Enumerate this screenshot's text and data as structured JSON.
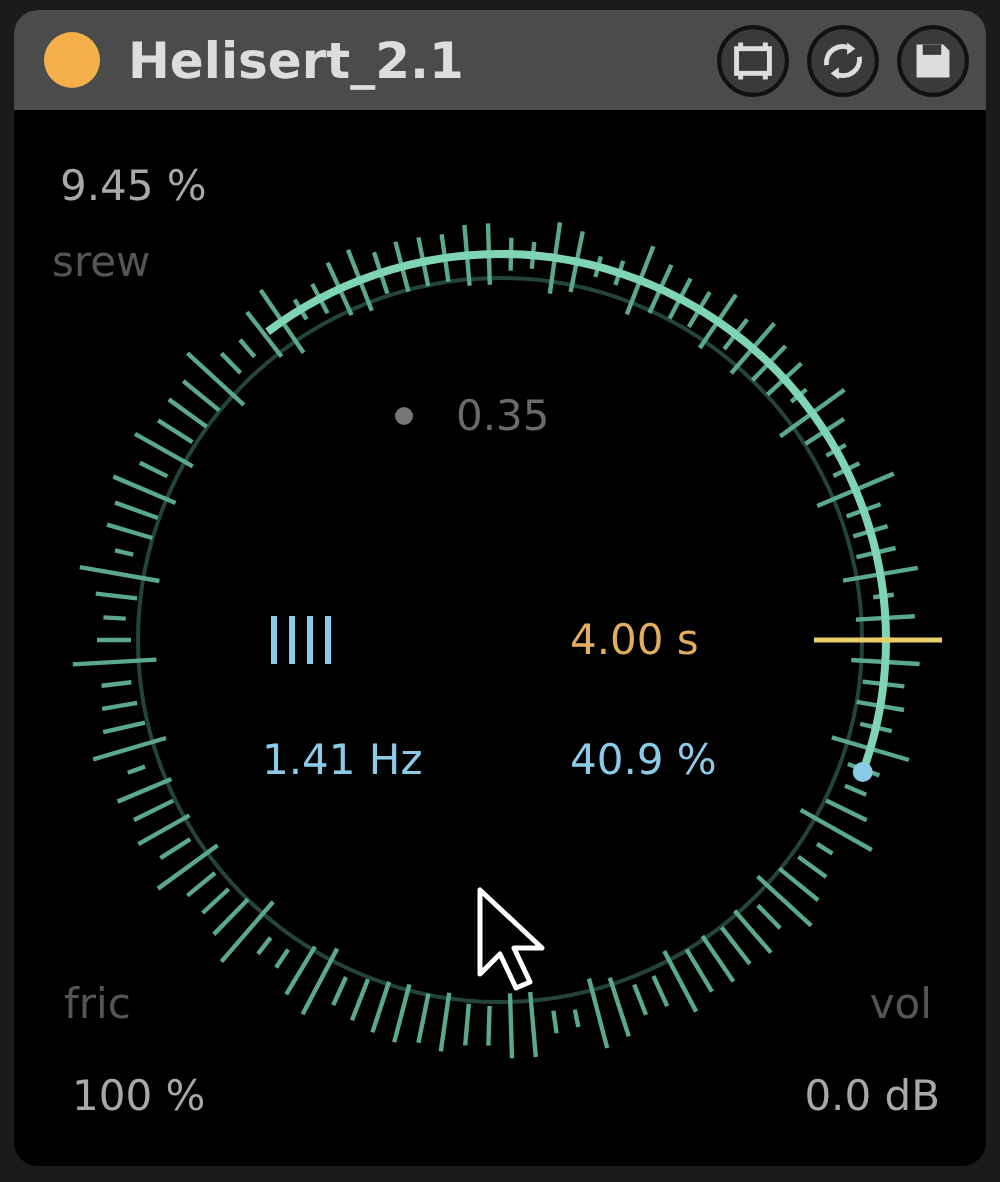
{
  "window": {
    "title": "Helisert_2.1"
  },
  "params": [
    {
      "value": "9.45 %",
      "label": "srew"
    },
    {
      "value": "100 %",
      "label": "fric"
    },
    {
      "value": "0.0 dB",
      "label": "vol"
    }
  ],
  "center_value": "0.35",
  "readouts": [
    {
      "text": "4.00 s",
      "color": "#e2ad5c"
    },
    {
      "text": "1.41 Hz",
      "color": "#8ccbe8"
    },
    {
      "text": "40.9 %",
      "color": "#8ccbe8"
    }
  ]
}
